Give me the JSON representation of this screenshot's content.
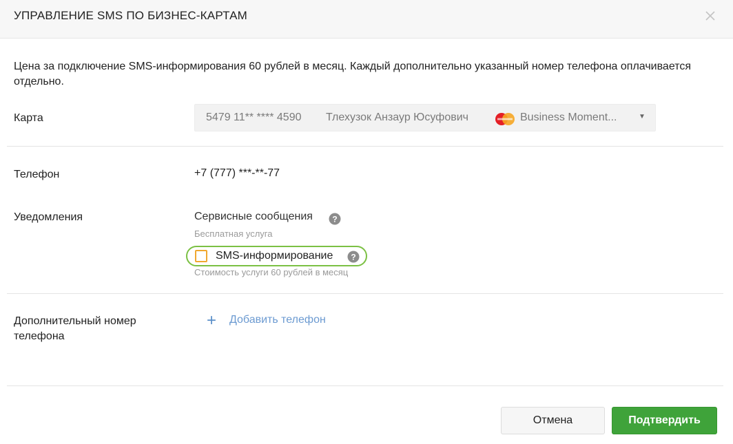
{
  "dialog": {
    "title": "УПРАВЛЕНИЕ SMS ПО БИЗНЕС-КАРТАМ",
    "intro": "Цена за подключение SMS-информирования 60 рублей в месяц. Каждый дополнительно указанный номер телефона оплачивается отдельно."
  },
  "card": {
    "label": "Карта",
    "number": "5479 11** **** 4590",
    "owner": "Тлехузок Анзаур Юсуфович",
    "product": "Business Moment...",
    "icon": "mastercard-logo"
  },
  "phone": {
    "label": "Телефон",
    "value": "+7 (777) ***-**-77"
  },
  "notifications": {
    "label": "Уведомления",
    "service_title": "Сервисные сообщения",
    "service_sub": "Бесплатная услуга",
    "sms_label": "SMS-информирование",
    "sms_checked": false,
    "sms_sub": "Стоимость услуги 60 рублей в месяц"
  },
  "extra_phone": {
    "label": "Дополнительный номер телефона",
    "add_label": "Добавить телефон"
  },
  "buttons": {
    "cancel": "Отмена",
    "confirm": "Подтвердить"
  },
  "colors": {
    "confirm": "#3fa33a",
    "highlight": "#7bc043",
    "link": "#6b9ad1",
    "checkbox_border": "#f0a830"
  }
}
